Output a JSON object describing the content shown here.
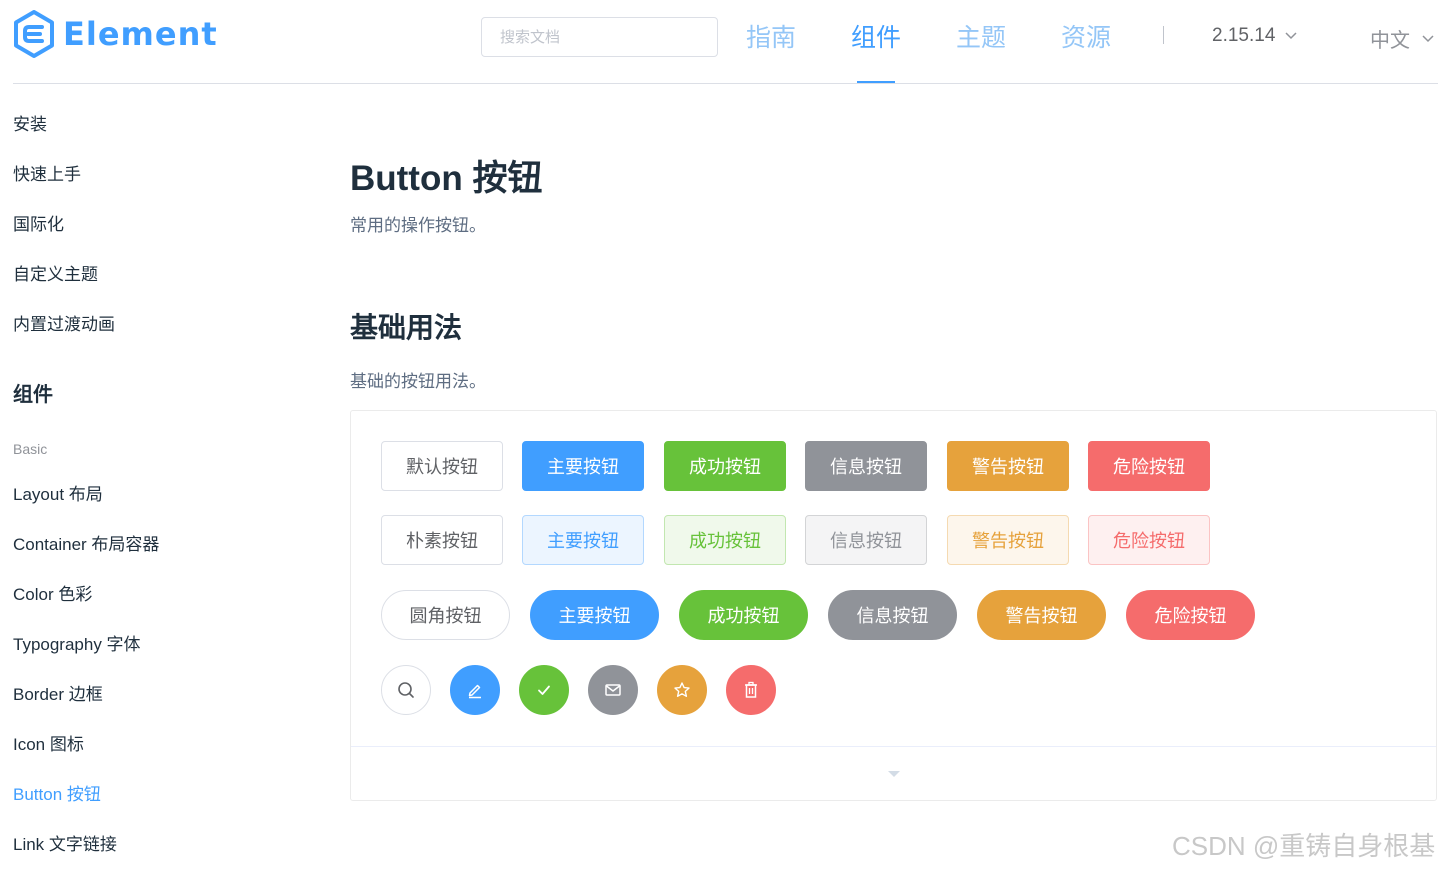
{
  "header": {
    "logo_text": "Element",
    "search_placeholder": "搜索文档",
    "nav": [
      {
        "label": "指南",
        "active": false
      },
      {
        "label": "组件",
        "active": true
      },
      {
        "label": "主题",
        "active": false
      },
      {
        "label": "资源",
        "active": false
      }
    ],
    "version": "2.15.14",
    "language": "中文"
  },
  "sidebar": {
    "items_top": [
      "安装",
      "快速上手",
      "国际化",
      "自定义主题",
      "内置过渡动画"
    ],
    "group_title": "组件",
    "subgroup_title": "Basic",
    "items_basic": [
      "Layout 布局",
      "Container 布局容器",
      "Color 色彩",
      "Typography 字体",
      "Border 边框",
      "Icon 图标",
      "Button 按钮",
      "Link 文字链接"
    ],
    "active_item": "Button 按钮"
  },
  "main": {
    "title": "Button 按钮",
    "description": "常用的操作按钮。",
    "section_title": "基础用法",
    "section_description": "基础的按钮用法。",
    "row_default": [
      "默认按钮",
      "主要按钮",
      "成功按钮",
      "信息按钮",
      "警告按钮",
      "危险按钮"
    ],
    "row_plain": [
      "朴素按钮",
      "主要按钮",
      "成功按钮",
      "信息按钮",
      "警告按钮",
      "危险按钮"
    ],
    "row_round": [
      "圆角按钮",
      "主要按钮",
      "成功按钮",
      "信息按钮",
      "警告按钮",
      "危险按钮"
    ],
    "row_circle_icons": [
      "search-icon",
      "edit-icon",
      "check-icon",
      "message-icon",
      "star-icon",
      "delete-icon"
    ]
  },
  "colors": {
    "primary": "#409EFF",
    "success": "#67C23A",
    "info": "#909399",
    "warning": "#E6A23C",
    "danger": "#F56C6C"
  },
  "watermark": "CSDN @重铸自身根基"
}
